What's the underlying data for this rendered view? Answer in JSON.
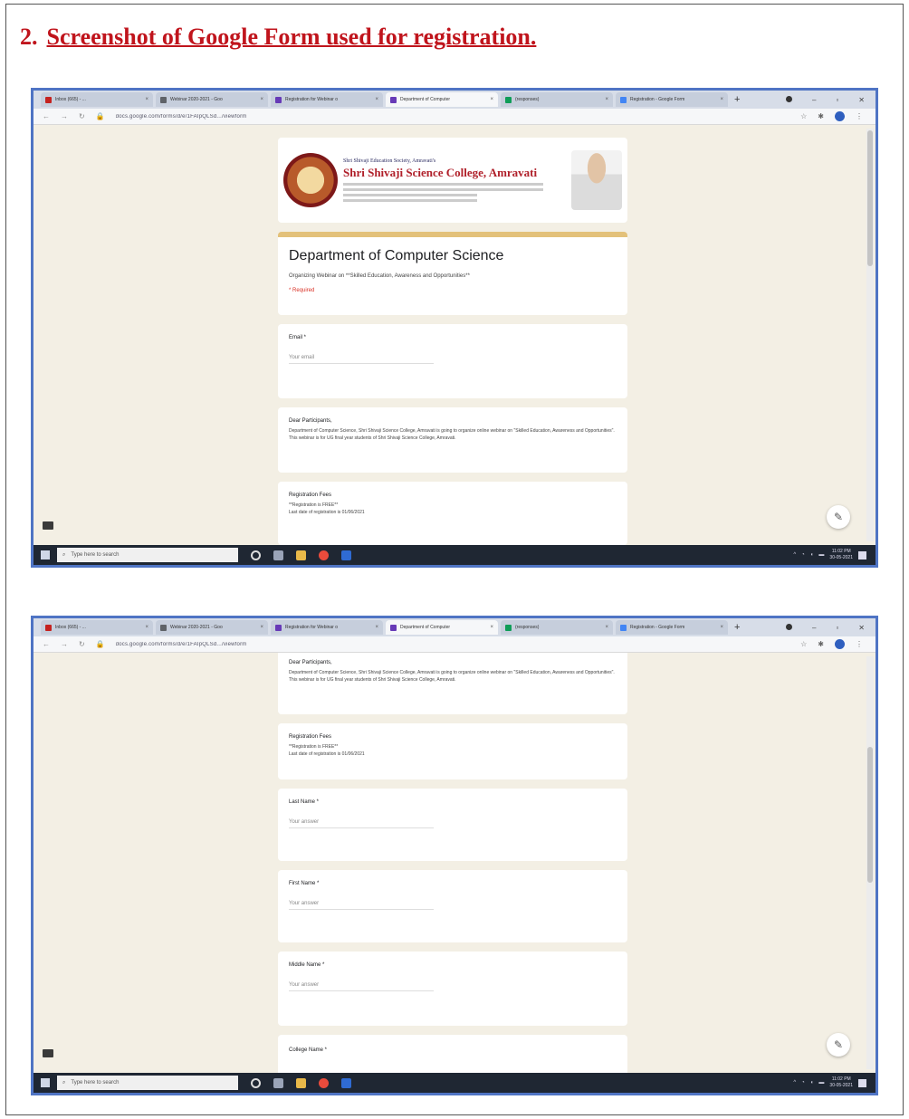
{
  "heading": {
    "number": "2.",
    "text": "Screenshot of Google Form used for registration."
  },
  "browser": {
    "tabs": [
      {
        "label": "Inbox (665) - ...",
        "color": "#c5221f"
      },
      {
        "label": "Webinar 2020-2021 - Goo",
        "color": "#5f6368"
      },
      {
        "label": "Registration for Webinar o",
        "color": "#673ab7"
      },
      {
        "label": "Department of Computer",
        "color": "#673ab7"
      },
      {
        "label": "(responses)",
        "color": "#0f9d58"
      },
      {
        "label": "Registration - Google Form",
        "color": "#4285f4"
      }
    ],
    "url": "docs.google.com/forms/d/e/1FAIpQLSd.../viewform"
  },
  "form": {
    "society": "Shri Shivaji Education Society, Amravati's",
    "college": "Shri Shivaji Science College, Amravati",
    "title": "Department of Computer Science",
    "subtitle": "Organizing Webinar on **Skilled Education, Awareness and Opportunities**",
    "required_note": "* Required",
    "email_label": "Email *",
    "answer_placeholder": "Your answer",
    "email_placeholder": "Your email",
    "participants_title": "Dear Participants,",
    "participants_body": "Department of Computer Science, Shri Shivaji Science College, Amravati is going to organize online webinar on \"Skilled Education, Awareness and Opportunities\". This webinar is for UG final year students of Shri Shivaji Science College, Amravati.",
    "fees_title": "Registration Fees",
    "fees_line1": "**Registration is FREE**",
    "fees_line2": "Last date of registration is 01/06/2021",
    "last_name": "Last Name *",
    "first_name": "First Name *",
    "middle_name": "Middle Name *",
    "college_name": "College Name *"
  },
  "taskbar": {
    "search": "Type here to search",
    "time": "11:02 PM",
    "date": "30-05-2021"
  },
  "colors": {
    "heading": "#c0141c",
    "frame": "#4f74c4",
    "page_bg": "#f3efe4"
  }
}
